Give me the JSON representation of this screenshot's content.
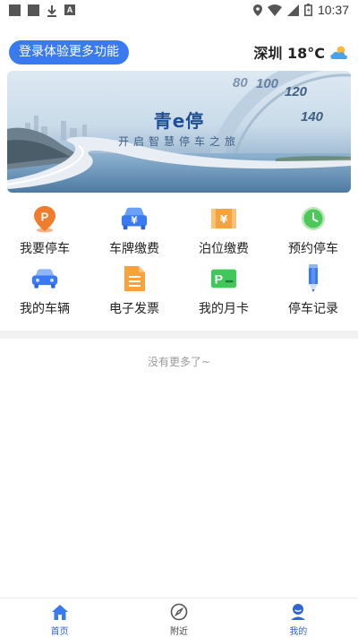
{
  "status_bar": {
    "time": "10:37"
  },
  "header": {
    "login_label": "登录体验更多功能",
    "weather_text": "深圳 18°C"
  },
  "banner": {
    "title": "青e停",
    "subtitle": "开启智慧停车之旅"
  },
  "functions": [
    {
      "label": "我要停车",
      "icon": "parking-pin-icon"
    },
    {
      "label": "车牌缴费",
      "icon": "car-fee-icon"
    },
    {
      "label": "泊位缴费",
      "icon": "berth-fee-icon"
    },
    {
      "label": "预约停车",
      "icon": "clock-icon"
    },
    {
      "label": "我的车辆",
      "icon": "car-icon"
    },
    {
      "label": "电子发票",
      "icon": "invoice-icon"
    },
    {
      "label": "我的月卡",
      "icon": "monthly-card-icon"
    },
    {
      "label": "停车记录",
      "icon": "pencil-icon"
    }
  ],
  "list": {
    "empty_text": "没有更多了~"
  },
  "tabs": [
    {
      "label": "首页",
      "icon": "home-icon",
      "active": false
    },
    {
      "label": "附近",
      "icon": "compass-icon",
      "active": false
    },
    {
      "label": "我的",
      "icon": "profile-icon",
      "active": true
    }
  ],
  "colors": {
    "accent": "#3a7af0",
    "tab_active": "#2f63d6"
  }
}
